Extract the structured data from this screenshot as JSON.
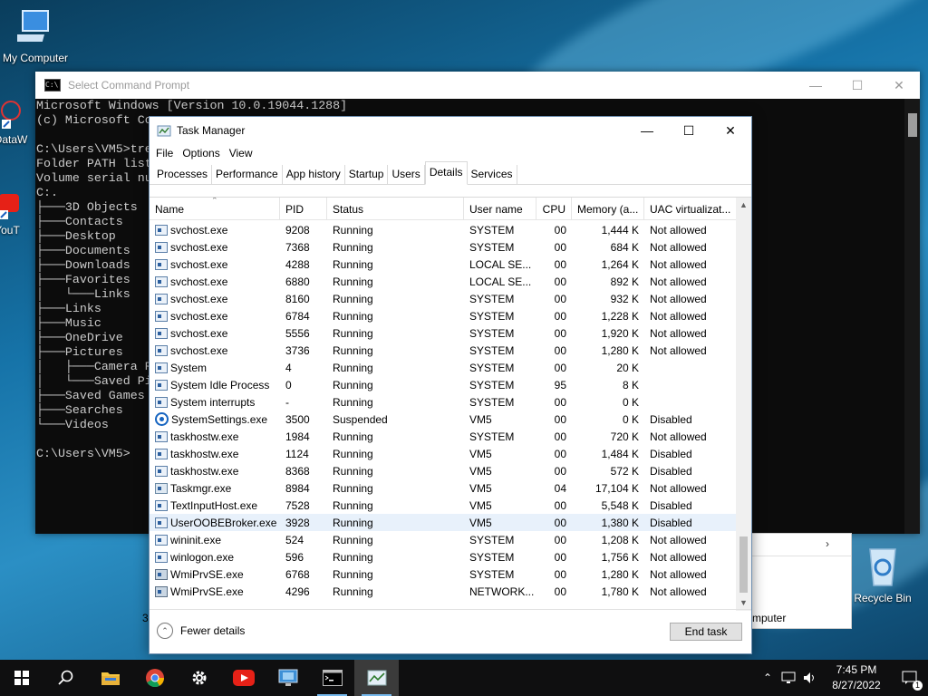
{
  "desktop": {
    "icons": [
      {
        "label": "My Computer",
        "icon": "computer-icon"
      },
      {
        "label": "DataW",
        "icon": "shortcut-icon"
      },
      {
        "label": "YouT",
        "icon": "youtube-shortcut-icon"
      },
      {
        "label": "Recycle Bin",
        "icon": "recycle-bin-icon"
      }
    ]
  },
  "cmd": {
    "title": "Select Command Prompt",
    "lines": [
      "Microsoft Windows [Version 10.0.19044.1288]",
      "(c) Microsoft Co",
      "",
      "C:\\Users\\VM5>tre",
      "Folder PATH list",
      "Volume serial nu",
      "C:.",
      "├───3D Objects",
      "├───Contacts",
      "├───Desktop",
      "├───Documents",
      "├───Downloads",
      "├───Favorites",
      "│   └───Links",
      "├───Links",
      "├───Music",
      "├───OneDrive",
      "├───Pictures",
      "│   ├───Camera R",
      "│   └───Saved Pi",
      "├───Saved Games",
      "├───Searches",
      "└───Videos",
      "",
      "C:\\Users\\VM5>"
    ]
  },
  "explorer": {
    "fragment_left": "3",
    "fragment_right": "mputer"
  },
  "taskmanager": {
    "title": "Task Manager",
    "menu": [
      "File",
      "Options",
      "View"
    ],
    "tabs": [
      "Processes",
      "Performance",
      "App history",
      "Startup",
      "Users",
      "Details",
      "Services"
    ],
    "active_tab": "Details",
    "columns": [
      "Name",
      "PID",
      "Status",
      "User name",
      "CPU",
      "Memory (a...",
      "UAC virtualizat..."
    ],
    "rows": [
      {
        "name": "svchost.exe",
        "pid": "9208",
        "status": "Running",
        "user": "SYSTEM",
        "cpu": "00",
        "mem": "1,444 K",
        "uac": "Not allowed",
        "icon": "svc"
      },
      {
        "name": "svchost.exe",
        "pid": "7368",
        "status": "Running",
        "user": "SYSTEM",
        "cpu": "00",
        "mem": "684 K",
        "uac": "Not allowed",
        "icon": "svc"
      },
      {
        "name": "svchost.exe",
        "pid": "4288",
        "status": "Running",
        "user": "LOCAL SE...",
        "cpu": "00",
        "mem": "1,264 K",
        "uac": "Not allowed",
        "icon": "svc"
      },
      {
        "name": "svchost.exe",
        "pid": "6880",
        "status": "Running",
        "user": "LOCAL SE...",
        "cpu": "00",
        "mem": "892 K",
        "uac": "Not allowed",
        "icon": "svc"
      },
      {
        "name": "svchost.exe",
        "pid": "8160",
        "status": "Running",
        "user": "SYSTEM",
        "cpu": "00",
        "mem": "932 K",
        "uac": "Not allowed",
        "icon": "svc"
      },
      {
        "name": "svchost.exe",
        "pid": "6784",
        "status": "Running",
        "user": "SYSTEM",
        "cpu": "00",
        "mem": "1,228 K",
        "uac": "Not allowed",
        "icon": "svc"
      },
      {
        "name": "svchost.exe",
        "pid": "5556",
        "status": "Running",
        "user": "SYSTEM",
        "cpu": "00",
        "mem": "1,920 K",
        "uac": "Not allowed",
        "icon": "svc"
      },
      {
        "name": "svchost.exe",
        "pid": "3736",
        "status": "Running",
        "user": "SYSTEM",
        "cpu": "00",
        "mem": "1,280 K",
        "uac": "Not allowed",
        "icon": "svc"
      },
      {
        "name": "System",
        "pid": "4",
        "status": "Running",
        "user": "SYSTEM",
        "cpu": "00",
        "mem": "20 K",
        "uac": "",
        "icon": "svc"
      },
      {
        "name": "System Idle Process",
        "pid": "0",
        "status": "Running",
        "user": "SYSTEM",
        "cpu": "95",
        "mem": "8 K",
        "uac": "",
        "icon": "svc"
      },
      {
        "name": "System interrupts",
        "pid": "-",
        "status": "Running",
        "user": "SYSTEM",
        "cpu": "00",
        "mem": "0 K",
        "uac": "",
        "icon": "svc"
      },
      {
        "name": "SystemSettings.exe",
        "pid": "3500",
        "status": "Suspended",
        "user": "VM5",
        "cpu": "00",
        "mem": "0 K",
        "uac": "Disabled",
        "icon": "gear"
      },
      {
        "name": "taskhostw.exe",
        "pid": "1984",
        "status": "Running",
        "user": "SYSTEM",
        "cpu": "00",
        "mem": "720 K",
        "uac": "Not allowed",
        "icon": "svc"
      },
      {
        "name": "taskhostw.exe",
        "pid": "1124",
        "status": "Running",
        "user": "VM5",
        "cpu": "00",
        "mem": "1,484 K",
        "uac": "Disabled",
        "icon": "svc"
      },
      {
        "name": "taskhostw.exe",
        "pid": "8368",
        "status": "Running",
        "user": "VM5",
        "cpu": "00",
        "mem": "572 K",
        "uac": "Disabled",
        "icon": "svc"
      },
      {
        "name": "Taskmgr.exe",
        "pid": "8984",
        "status": "Running",
        "user": "VM5",
        "cpu": "04",
        "mem": "17,104 K",
        "uac": "Not allowed",
        "icon": "mgr"
      },
      {
        "name": "TextInputHost.exe",
        "pid": "7528",
        "status": "Running",
        "user": "VM5",
        "cpu": "00",
        "mem": "5,548 K",
        "uac": "Disabled",
        "icon": "svc"
      },
      {
        "name": "UserOOBEBroker.exe",
        "pid": "3928",
        "status": "Running",
        "user": "VM5",
        "cpu": "00",
        "mem": "1,380 K",
        "uac": "Disabled",
        "icon": "svc",
        "selected": true
      },
      {
        "name": "wininit.exe",
        "pid": "524",
        "status": "Running",
        "user": "SYSTEM",
        "cpu": "00",
        "mem": "1,208 K",
        "uac": "Not allowed",
        "icon": "svc"
      },
      {
        "name": "winlogon.exe",
        "pid": "596",
        "status": "Running",
        "user": "SYSTEM",
        "cpu": "00",
        "mem": "1,756 K",
        "uac": "Not allowed",
        "icon": "svc"
      },
      {
        "name": "WmiPrvSE.exe",
        "pid": "6768",
        "status": "Running",
        "user": "SYSTEM",
        "cpu": "00",
        "mem": "1,280 K",
        "uac": "Not allowed",
        "icon": "wmi"
      },
      {
        "name": "WmiPrvSE.exe",
        "pid": "4296",
        "status": "Running",
        "user": "NETWORK...",
        "cpu": "00",
        "mem": "1,780 K",
        "uac": "Not allowed",
        "icon": "wmi"
      }
    ],
    "fewer_details": "Fewer details",
    "end_task": "End task"
  },
  "taskbar": {
    "apps": [
      "start-icon",
      "search-icon",
      "file-explorer-icon",
      "chrome-icon",
      "settings-icon",
      "youtube-icon",
      "remote-desktop-icon",
      "command-prompt-icon",
      "task-manager-icon"
    ],
    "time": "7:45 PM",
    "date": "8/27/2022",
    "notifications": "1"
  }
}
